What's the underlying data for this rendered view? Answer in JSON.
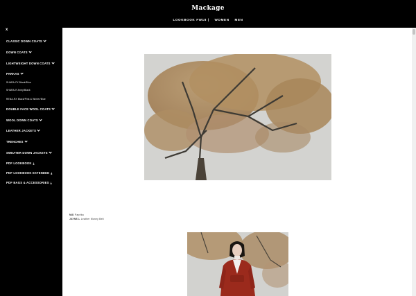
{
  "header": {
    "logo": "Mackage",
    "nav": [
      "LOOKBOOK FW18 |",
      "WOMEN",
      "MEN"
    ]
  },
  "sidebar": {
    "close": "x",
    "items": [
      {
        "label": "CLASSIC DOWN COATS",
        "chevron": true
      },
      {
        "label": "DOWN COATS",
        "chevron": true
      },
      {
        "label": "LIGHTWEIGHT DOWN COATS",
        "chevron": true
      },
      {
        "label": "PARKAS",
        "chevron": true
      },
      {
        "label": "SHARA-FX Black/Blue",
        "sub": true
      },
      {
        "label": "SHARA-R Army/Black",
        "sub": true
      },
      {
        "label": "RENA-RX Black/Pink & Winter/Blue",
        "sub": true
      },
      {
        "label": "DOUBLE FACE WOOL COATS",
        "chevron": true
      },
      {
        "label": "WOOL DOWN COATS",
        "chevron": true
      },
      {
        "label": "LEATHER JACKETS",
        "chevron": true
      },
      {
        "label": "TRENCHES",
        "chevron": true
      },
      {
        "label": "SWEATER DOWN JACKETS",
        "chevron": true
      },
      {
        "label": "PDF LOOKBOOK",
        "download": true
      },
      {
        "label": "PDF LOOKBOOK EXTENDED",
        "download": true
      },
      {
        "label": "PDF BAGS & ACCESSORIES",
        "download": true
      }
    ]
  },
  "main": {
    "caption_line1_key": "MAI",
    "caption_line1_value": "Paprika",
    "caption_line2_key": "JAYNE-L",
    "caption_line2_value": "Leather Money Belt"
  },
  "icons": {
    "chevron": "chevron-down-icon",
    "download": "download-icon",
    "close": "close-icon"
  },
  "colors": {
    "sidebar_bg": "#000000",
    "header_bg": "#000000",
    "coat_red": "#9b2a1c"
  }
}
